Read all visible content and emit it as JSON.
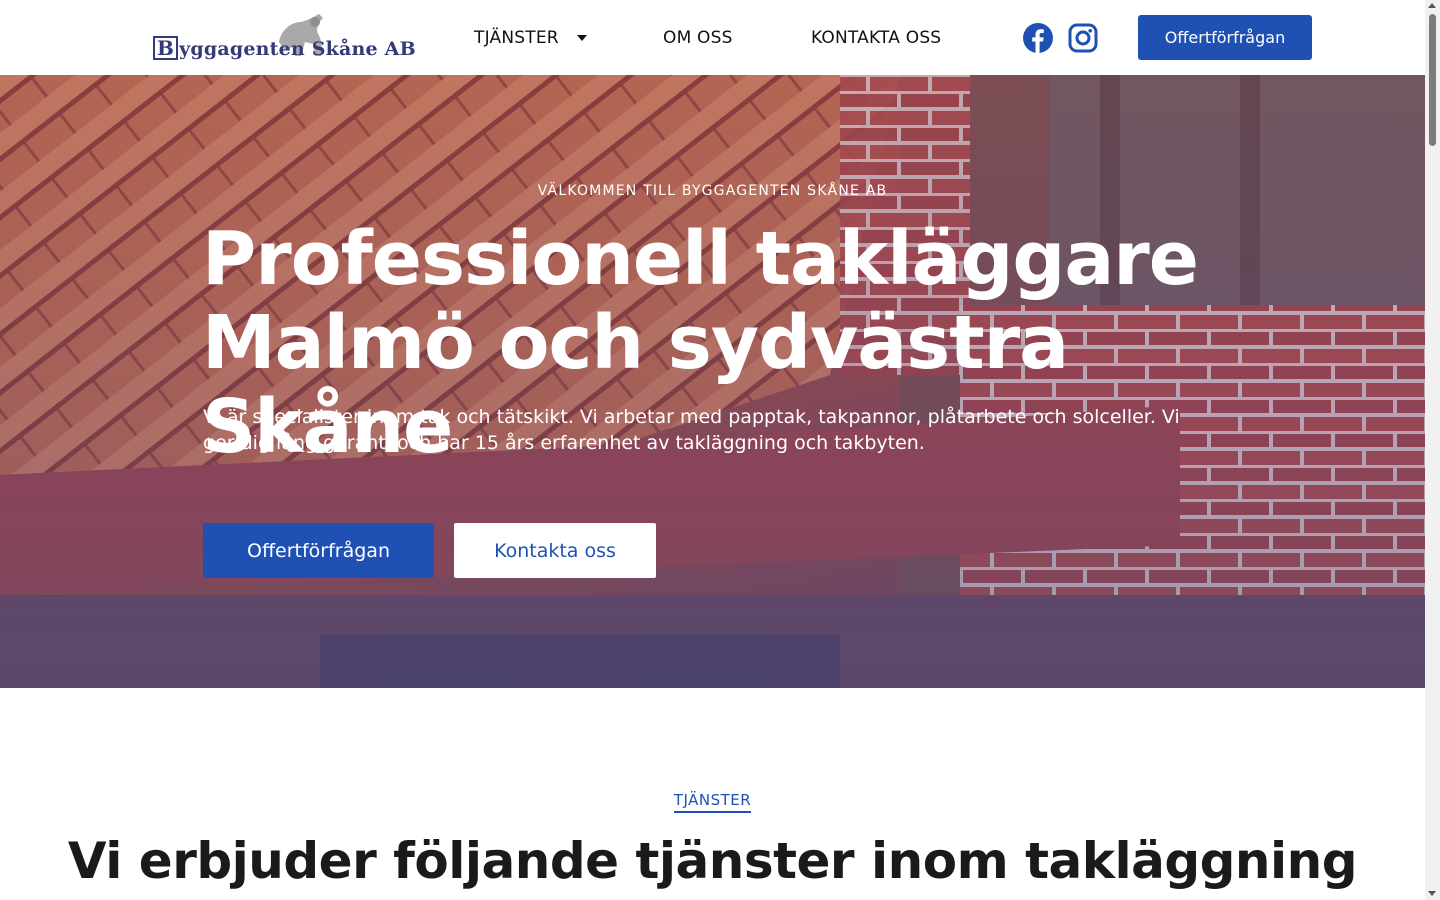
{
  "header": {
    "logo_text": "yggagenten Skåne AB",
    "logo_letter": "B",
    "nav": {
      "services": "TJÄNSTER",
      "about": "OM OSS",
      "contact": "KONTAKTA OSS"
    },
    "social": [
      "facebook-icon",
      "instagram-icon"
    ],
    "cta": "Offertförfrågan"
  },
  "hero": {
    "kicker": "VÄLKOMMEN TILL BYGGAGENTEN SKÅNE AB",
    "title_line1": "Professionell takläggare",
    "title_line2": "Malmö och sydvästra Skåne",
    "text": "Vi är specialister inom tak och tätskikt. Vi arbetar med papptak, takpannor, plåtarbete och solceller. Vi ger dig lång garanti och har 15 års erfarenhet av takläggning och takbyten.",
    "primary_button": "Offertförfrågan",
    "secondary_button": "Kontakta oss"
  },
  "services": {
    "kicker": "TJÄNSTER",
    "title": "Vi erbjuder följande tjänster inom takläggning"
  },
  "colors": {
    "accent": "#1f51b5",
    "logo": "#333a78"
  }
}
